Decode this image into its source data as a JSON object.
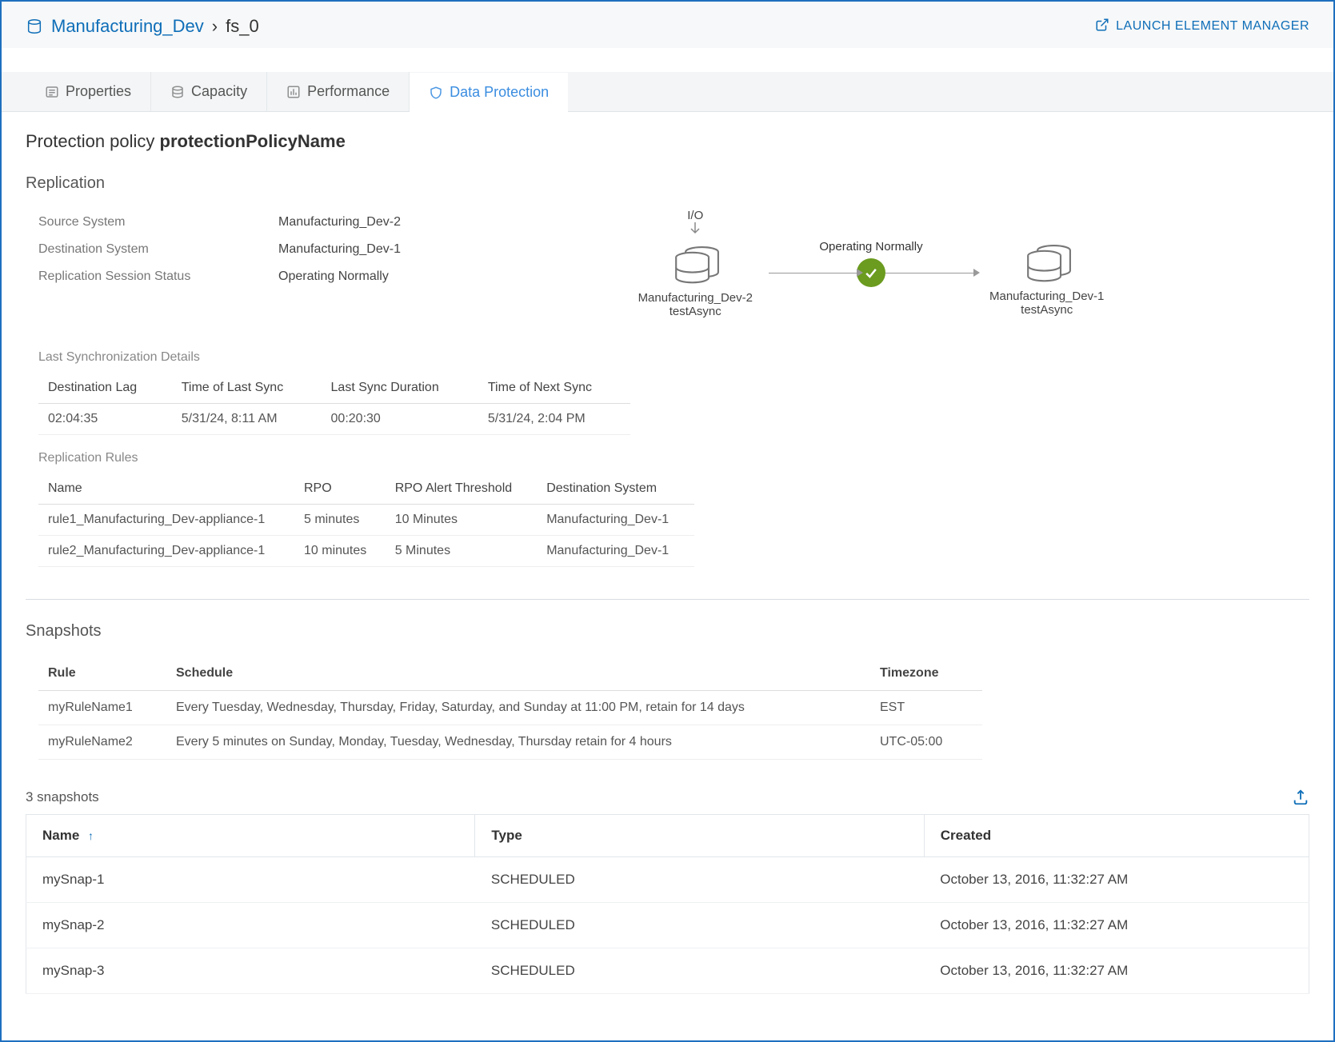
{
  "breadcrumb": {
    "parent": "Manufacturing_Dev",
    "current": "fs_0"
  },
  "launch_link": "LAUNCH ELEMENT MANAGER",
  "tabs": {
    "properties": "Properties",
    "capacity": "Capacity",
    "performance": "Performance",
    "data_protection": "Data Protection"
  },
  "policy": {
    "prefix": "Protection policy ",
    "name": "protectionPolicyName"
  },
  "replication": {
    "heading": "Replication",
    "labels": {
      "source": "Source System",
      "destination": "Destination System",
      "status": "Replication Session Status"
    },
    "values": {
      "source": "Manufacturing_Dev-2",
      "destination": "Manufacturing_Dev-1",
      "status": "Operating Normally"
    },
    "diagram": {
      "io_label": "I/O",
      "left_name": "Manufacturing_Dev-2",
      "left_sub": "testAsync",
      "edge_label": "Operating Normally",
      "right_name": "Manufacturing_Dev-1",
      "right_sub": "testAsync"
    },
    "sync_details_label": "Last Synchronization Details",
    "sync_headers": {
      "lag": "Destination Lag",
      "last": "Time of Last Sync",
      "dur": "Last Sync Duration",
      "next": "Time of Next Sync"
    },
    "sync_row": {
      "lag": "02:04:35",
      "last": "5/31/24, 8:11 AM",
      "dur": "00:20:30",
      "next": "5/31/24, 2:04 PM"
    },
    "rules_label": "Replication Rules",
    "rules_headers": {
      "name": "Name",
      "rpo": "RPO",
      "thr": "RPO Alert Threshold",
      "dest": "Destination System"
    },
    "rules": [
      {
        "name": "rule1_Manufacturing_Dev-appliance-1",
        "rpo": "5 minutes",
        "thr": "10 Minutes",
        "dest": "Manufacturing_Dev-1"
      },
      {
        "name": "rule2_Manufacturing_Dev-appliance-1",
        "rpo": "10 minutes",
        "thr": "5 Minutes",
        "dest": "Manufacturing_Dev-1"
      }
    ]
  },
  "snapshots": {
    "heading": "Snapshots",
    "rules_headers": {
      "rule": "Rule",
      "schedule": "Schedule",
      "tz": "Timezone"
    },
    "rules": [
      {
        "rule": "myRuleName1",
        "schedule": "Every Tuesday, Wednesday, Thursday, Friday, Saturday, and Sunday at 11:00 PM, retain for 14 days",
        "tz": "EST"
      },
      {
        "rule": "myRuleName2",
        "schedule": "Every 5 minutes on Sunday, Monday, Tuesday, Wednesday, Thursday retain for 4 hours",
        "tz": "UTC-05:00"
      }
    ],
    "count_label": "3 snapshots",
    "table_headers": {
      "name": "Name",
      "type": "Type",
      "created": "Created"
    },
    "rows": [
      {
        "name": "mySnap-1",
        "type": "SCHEDULED",
        "created": "October 13, 2016, 11:32:27 AM"
      },
      {
        "name": "mySnap-2",
        "type": "SCHEDULED",
        "created": "October 13, 2016, 11:32:27 AM"
      },
      {
        "name": "mySnap-3",
        "type": "SCHEDULED",
        "created": "October 13, 2016, 11:32:27 AM"
      }
    ]
  }
}
